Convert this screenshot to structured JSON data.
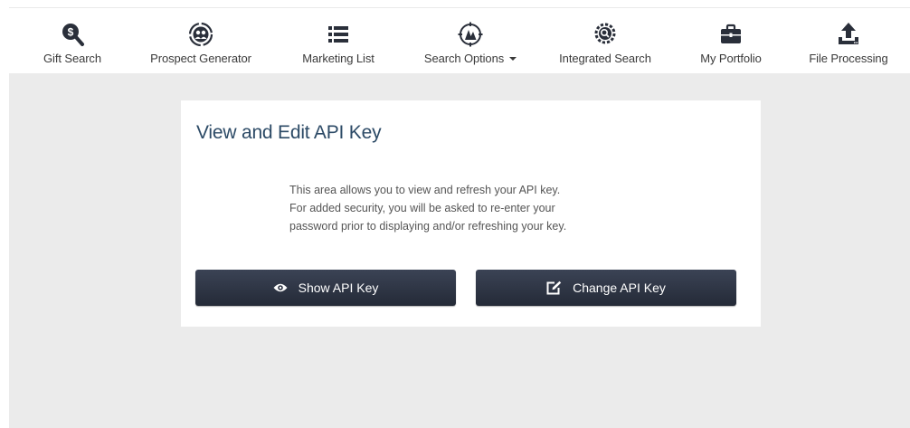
{
  "nav": {
    "items": [
      {
        "label": "Gift Search",
        "icon": "dollar-search-icon"
      },
      {
        "label": "Prospect Generator",
        "icon": "people-group-icon"
      },
      {
        "label": "Marketing List",
        "icon": "list-icon"
      },
      {
        "label": "Search Options",
        "icon": "compass-icon",
        "dropdown": true
      },
      {
        "label": "Integrated Search",
        "icon": "gear-search-icon"
      },
      {
        "label": "My Portfolio",
        "icon": "briefcase-icon"
      },
      {
        "label": "File Processing",
        "icon": "upload-icon"
      }
    ]
  },
  "card": {
    "title": "View and Edit API Key",
    "description_lines": [
      "This area allows you to view and refresh your API key.",
      "For added security, you will be asked to re-enter your",
      "password prior to displaying and/or refreshing your key."
    ],
    "show_button_label": "Show API Key",
    "change_button_label": "Change API Key"
  },
  "colors": {
    "content_background": "#ebebeb",
    "title_color": "#2c4a66",
    "button_color": "#2e3443",
    "icon_color": "#2a2f3a"
  }
}
